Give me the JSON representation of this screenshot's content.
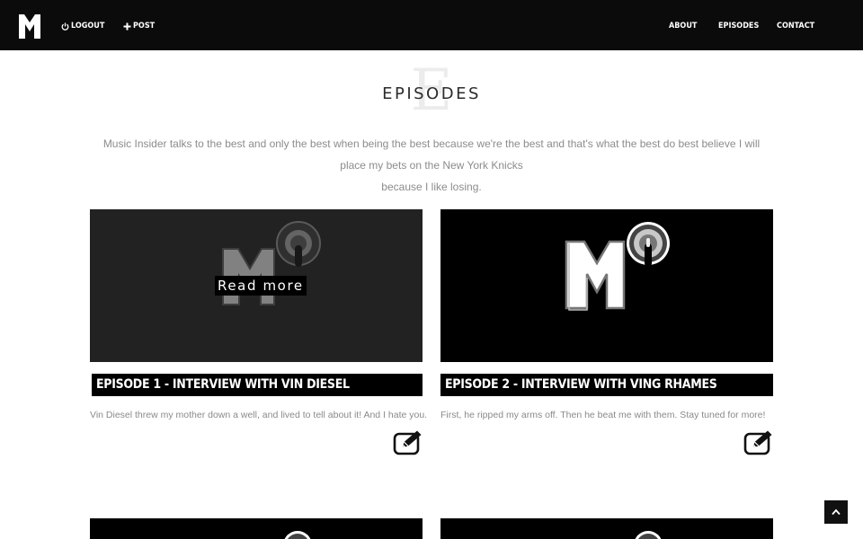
{
  "nav": {
    "logout_label": "LOGOUT",
    "post_label": "POST",
    "items": [
      {
        "label": "ABOUT"
      },
      {
        "label": "EPISODES"
      },
      {
        "label": "CONTACT"
      }
    ]
  },
  "section": {
    "bg_letter": "E",
    "title": "EPISODES",
    "intro_line1": "Music Insider talks to the best and only the best when being the best because we're the best and that's what the best do best believe I will place my bets on the New York Knicks",
    "intro_line2": "because I like losing."
  },
  "episodes": [
    {
      "title": "EPISODE 1 - INTERVIEW WITH VIN DIESEL",
      "description": "Vin Diesel threw my mother down a well, and lived to tell about it! And I hate you.",
      "overlay_label": "Read more"
    },
    {
      "title": "EPISODE 2 - INTERVIEW WITH VING RHAMES",
      "description": "First, he ripped my arms off. Then he beat me with them. Stay tuned for more!"
    }
  ],
  "colors": {
    "navbar": "#0b0b0b",
    "thumb_bg": "#000000",
    "thumb_hover_bg": "#222222",
    "text_muted": "#8c8c8c"
  }
}
